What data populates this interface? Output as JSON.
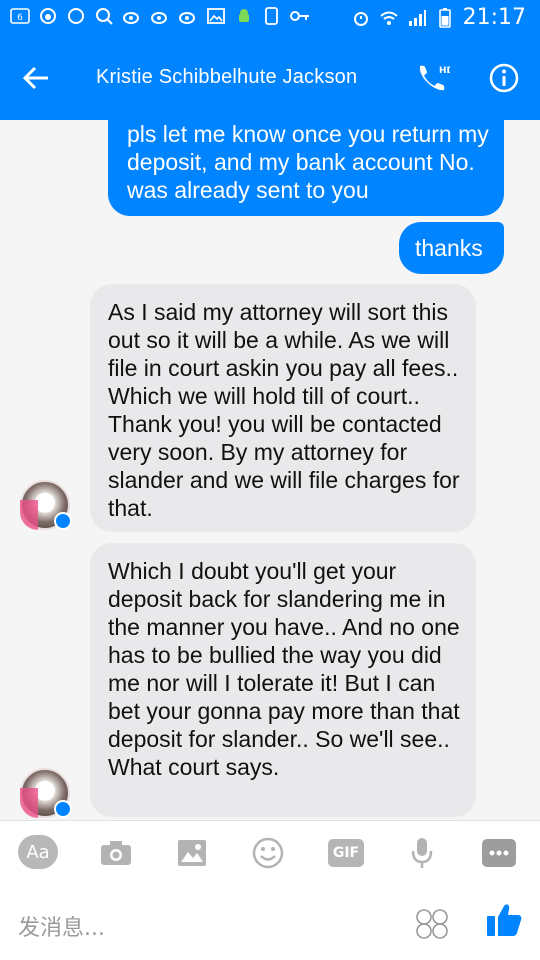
{
  "status_bar": {
    "time": "21:17",
    "left_icons": [
      "notification-6-icon",
      "weibo-icon",
      "circle-icon",
      "search-icon",
      "weibo-icon",
      "weibo-icon",
      "weibo-icon",
      "image-icon",
      "android-icon",
      "phone-icon",
      "key-icon"
    ],
    "right_icons": [
      "alarm-icon",
      "wifi-icon",
      "signal-icon",
      "battery-icon"
    ]
  },
  "header": {
    "title": "Kristie Schibbelhute Jackson",
    "call_badge": "HD"
  },
  "messages": [
    {
      "direction": "outgoing",
      "text": "pls let me know once you return my deposit, and my bank account No. was already sent to you"
    },
    {
      "direction": "outgoing",
      "text": "thanks"
    },
    {
      "direction": "incoming",
      "text": "As I said my attorney will sort this out so it will be a while.  As we will file in court askin you pay all fees.. Which we will hold till of court.. Thank you!  you will be contacted very soon. By my attorney for slander and we will file charges for that."
    },
    {
      "direction": "incoming",
      "text": "Which I doubt you'll get your deposit back for slandering me in the manner you have.. And no one has to be bullied the way you did me nor will I tolerate it! But I can bet your gonna pay more than that deposit for slander.. So we'll see.. What court says."
    }
  ],
  "toolbar": {
    "aa_label": "Aa",
    "gif_label": "GIF"
  },
  "composer": {
    "placeholder": "发消息..."
  },
  "colors": {
    "brand_blue": "#0084ff",
    "incoming_bubble": "#e9e9eb"
  }
}
